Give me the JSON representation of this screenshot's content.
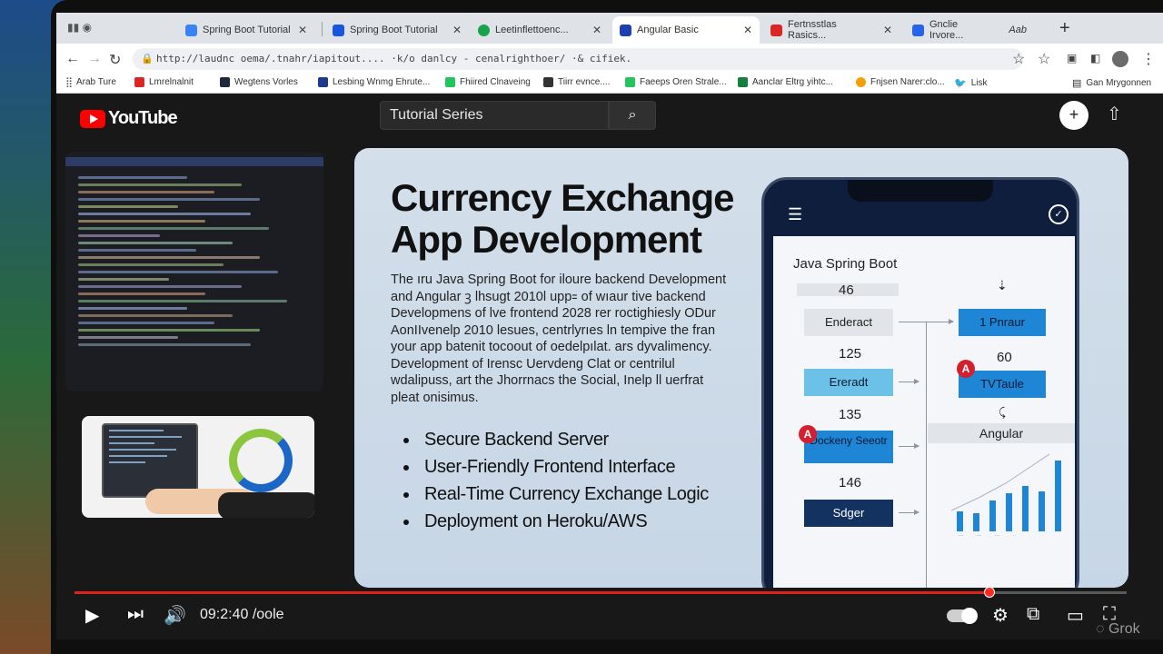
{
  "browser": {
    "tabs": [
      {
        "label": "Spring Boot Tutorial",
        "color": "#3b82f6"
      },
      {
        "label": "Spring Boot Tutorial",
        "color": "#1a56db"
      },
      {
        "label": "Leetinflettoenc...",
        "color": "#16a34a"
      },
      {
        "label": "Angular Basic",
        "color": "#1e40af"
      },
      {
        "label": "Fertnsstlas Rasics...",
        "color": "#dc2626"
      },
      {
        "label": "Gnclie Irvore...",
        "color": "#2563eb"
      }
    ],
    "tab_extra": "Aab",
    "new_tab": "+",
    "url": "http://laudnc oema/.tnahr/iapitout....  ·k/o danlcy - cenalrighthoer/  ·& cifiek.",
    "bookmarks": [
      {
        "label": "Arab Ture",
        "color": "#555555"
      },
      {
        "label": "Lmrelnalnit",
        "color": "#dc2626"
      },
      {
        "label": "Wegtens Vorles",
        "color": "#1f2937"
      },
      {
        "label": "Lesbing Wnmg Ehrute...",
        "color": "#1e3a8a"
      },
      {
        "label": "Fhiired Clnaveing",
        "color": "#22c55e"
      },
      {
        "label": "Tiirr evnce....",
        "color": "#333333"
      },
      {
        "label": "Faeeps Oren Strale...",
        "color": "#22c55e"
      },
      {
        "label": "Aanclar Eltrg yihtc...",
        "color": "#15803d"
      },
      {
        "label": "Fnjsen Narer:clo...",
        "color": "#f59e0b"
      },
      {
        "label": "Lisk",
        "color": "#1d9bf0"
      }
    ],
    "bookmarks_right": "Gan Mrygonnen"
  },
  "youtube": {
    "logo_text": "YouTube",
    "search_value": "Tutorial Series",
    "create_label": "+"
  },
  "slide": {
    "title_line1": "Currency Exchange",
    "title_line2": "App Development",
    "description": "The ıru Java Spring Boot for iloure backend Development and Angular ꝫ lhsugt 2010l upp꞊ of wıaur tive backend Developmens of Ɩve frontend 2028 rer roctighiesly ODur AonIIvenelp 2010 lesues, centrlyrıes ln tempive the fran your app batenit tocoout of oedelpılat. ars dyvalimency. Development of Irensc Uervdeng Clat or centrilul wdalipuss, art the Jhorrnacs the Social, Inelp ll uerfrat pleat onisimus.",
    "bullets": [
      "Secure Backend Server",
      "User-Friendly Frontend Interface",
      "Real-Time Currency Exchange Logic",
      "Deployment on Heroku/AWS"
    ]
  },
  "phone": {
    "screen_title": "Java Spring Boot",
    "badge_letter": "A",
    "nodes": {
      "n46": "46",
      "endeact": "Enderact",
      "n125": "125",
      "ereadt": "Ereradt",
      "n135": "135",
      "dockeny": "Dockeny Seeotr",
      "n146": "146",
      "sdger": "Sdger",
      "rmur": "1 Pnraur",
      "n60": "60",
      "tvtaule": "TVTaule",
      "angular": "Angular"
    },
    "chart_bars": [
      22,
      20,
      34,
      42,
      50,
      44,
      78
    ]
  },
  "player": {
    "time": "09:2:40 /oole",
    "progress": 0.87,
    "watermark": "Grok"
  }
}
